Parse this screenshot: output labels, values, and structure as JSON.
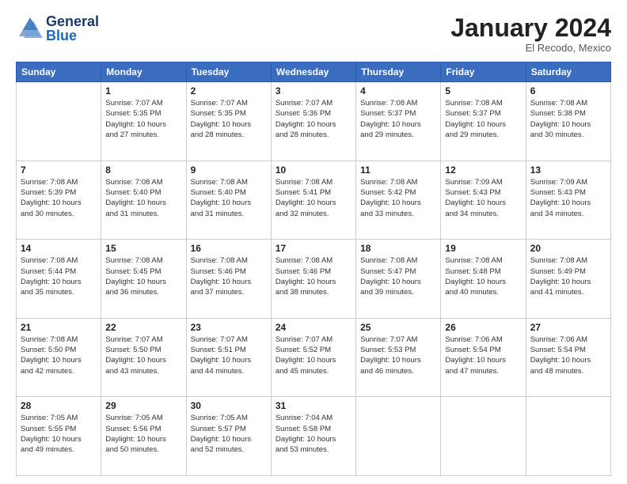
{
  "header": {
    "logo_text_general": "General",
    "logo_text_blue": "Blue",
    "month_year": "January 2024",
    "location": "El Recodo, Mexico"
  },
  "weekdays": [
    "Sunday",
    "Monday",
    "Tuesday",
    "Wednesday",
    "Thursday",
    "Friday",
    "Saturday"
  ],
  "weeks": [
    [
      {
        "day": "",
        "info": ""
      },
      {
        "day": "1",
        "info": "Sunrise: 7:07 AM\nSunset: 5:35 PM\nDaylight: 10 hours\nand 27 minutes."
      },
      {
        "day": "2",
        "info": "Sunrise: 7:07 AM\nSunset: 5:35 PM\nDaylight: 10 hours\nand 28 minutes."
      },
      {
        "day": "3",
        "info": "Sunrise: 7:07 AM\nSunset: 5:36 PM\nDaylight: 10 hours\nand 28 minutes."
      },
      {
        "day": "4",
        "info": "Sunrise: 7:08 AM\nSunset: 5:37 PM\nDaylight: 10 hours\nand 29 minutes."
      },
      {
        "day": "5",
        "info": "Sunrise: 7:08 AM\nSunset: 5:37 PM\nDaylight: 10 hours\nand 29 minutes."
      },
      {
        "day": "6",
        "info": "Sunrise: 7:08 AM\nSunset: 5:38 PM\nDaylight: 10 hours\nand 30 minutes."
      }
    ],
    [
      {
        "day": "7",
        "info": "Sunrise: 7:08 AM\nSunset: 5:39 PM\nDaylight: 10 hours\nand 30 minutes."
      },
      {
        "day": "8",
        "info": "Sunrise: 7:08 AM\nSunset: 5:40 PM\nDaylight: 10 hours\nand 31 minutes."
      },
      {
        "day": "9",
        "info": "Sunrise: 7:08 AM\nSunset: 5:40 PM\nDaylight: 10 hours\nand 31 minutes."
      },
      {
        "day": "10",
        "info": "Sunrise: 7:08 AM\nSunset: 5:41 PM\nDaylight: 10 hours\nand 32 minutes."
      },
      {
        "day": "11",
        "info": "Sunrise: 7:08 AM\nSunset: 5:42 PM\nDaylight: 10 hours\nand 33 minutes."
      },
      {
        "day": "12",
        "info": "Sunrise: 7:09 AM\nSunset: 5:43 PM\nDaylight: 10 hours\nand 34 minutes."
      },
      {
        "day": "13",
        "info": "Sunrise: 7:09 AM\nSunset: 5:43 PM\nDaylight: 10 hours\nand 34 minutes."
      }
    ],
    [
      {
        "day": "14",
        "info": "Sunrise: 7:08 AM\nSunset: 5:44 PM\nDaylight: 10 hours\nand 35 minutes."
      },
      {
        "day": "15",
        "info": "Sunrise: 7:08 AM\nSunset: 5:45 PM\nDaylight: 10 hours\nand 36 minutes."
      },
      {
        "day": "16",
        "info": "Sunrise: 7:08 AM\nSunset: 5:46 PM\nDaylight: 10 hours\nand 37 minutes."
      },
      {
        "day": "17",
        "info": "Sunrise: 7:08 AM\nSunset: 5:46 PM\nDaylight: 10 hours\nand 38 minutes."
      },
      {
        "day": "18",
        "info": "Sunrise: 7:08 AM\nSunset: 5:47 PM\nDaylight: 10 hours\nand 39 minutes."
      },
      {
        "day": "19",
        "info": "Sunrise: 7:08 AM\nSunset: 5:48 PM\nDaylight: 10 hours\nand 40 minutes."
      },
      {
        "day": "20",
        "info": "Sunrise: 7:08 AM\nSunset: 5:49 PM\nDaylight: 10 hours\nand 41 minutes."
      }
    ],
    [
      {
        "day": "21",
        "info": "Sunrise: 7:08 AM\nSunset: 5:50 PM\nDaylight: 10 hours\nand 42 minutes."
      },
      {
        "day": "22",
        "info": "Sunrise: 7:07 AM\nSunset: 5:50 PM\nDaylight: 10 hours\nand 43 minutes."
      },
      {
        "day": "23",
        "info": "Sunrise: 7:07 AM\nSunset: 5:51 PM\nDaylight: 10 hours\nand 44 minutes."
      },
      {
        "day": "24",
        "info": "Sunrise: 7:07 AM\nSunset: 5:52 PM\nDaylight: 10 hours\nand 45 minutes."
      },
      {
        "day": "25",
        "info": "Sunrise: 7:07 AM\nSunset: 5:53 PM\nDaylight: 10 hours\nand 46 minutes."
      },
      {
        "day": "26",
        "info": "Sunrise: 7:06 AM\nSunset: 5:54 PM\nDaylight: 10 hours\nand 47 minutes."
      },
      {
        "day": "27",
        "info": "Sunrise: 7:06 AM\nSunset: 5:54 PM\nDaylight: 10 hours\nand 48 minutes."
      }
    ],
    [
      {
        "day": "28",
        "info": "Sunrise: 7:05 AM\nSunset: 5:55 PM\nDaylight: 10 hours\nand 49 minutes."
      },
      {
        "day": "29",
        "info": "Sunrise: 7:05 AM\nSunset: 5:56 PM\nDaylight: 10 hours\nand 50 minutes."
      },
      {
        "day": "30",
        "info": "Sunrise: 7:05 AM\nSunset: 5:57 PM\nDaylight: 10 hours\nand 52 minutes."
      },
      {
        "day": "31",
        "info": "Sunrise: 7:04 AM\nSunset: 5:58 PM\nDaylight: 10 hours\nand 53 minutes."
      },
      {
        "day": "",
        "info": ""
      },
      {
        "day": "",
        "info": ""
      },
      {
        "day": "",
        "info": ""
      }
    ]
  ]
}
